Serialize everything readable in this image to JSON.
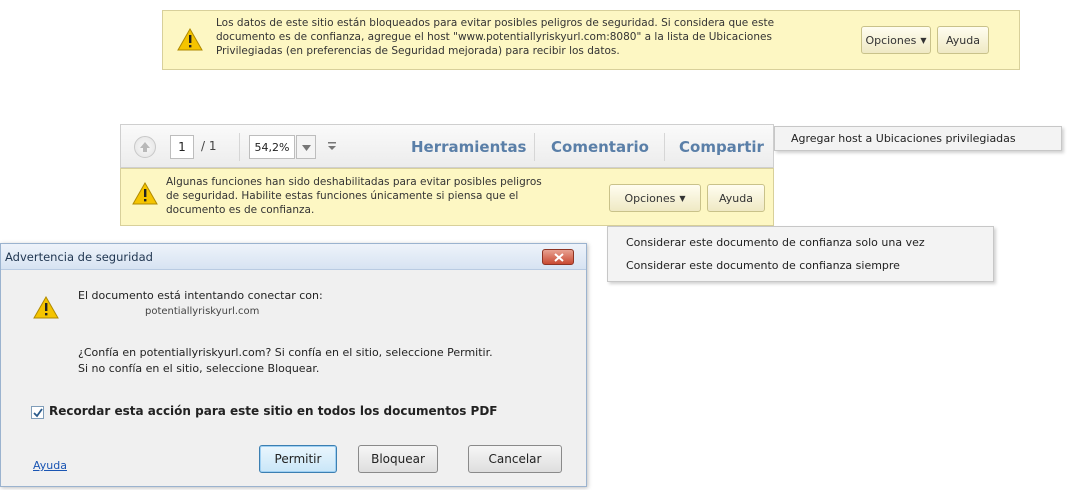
{
  "bar1": {
    "message_lines": [
      "Los datos de este sitio están bloqueados para evitar posibles peligros de seguridad. Si considera que este",
      "documento es de confianza, agregue el host  \"www.potentiallyriskyurl.com:8080\"  a la lista de Ubicaciones",
      "Privilegiadas (en preferencias de Seguridad mejorada) para recibir los datos."
    ],
    "options_label": "Opciones",
    "help_label": "Ayuda"
  },
  "toolbar": {
    "page_current": "1",
    "page_total": "/ 1",
    "zoom": "54,2%",
    "tools_label": "Herramientas",
    "comment_label": "Comentario",
    "share_label": "Compartir"
  },
  "menu1": {
    "item": "Agregar host a Ubicaciones privilegiadas"
  },
  "bar2": {
    "message_lines": [
      "Algunas funciones han sido deshabilitadas para evitar posibles peligros",
      "de seguridad. Habilite estas funciones únicamente si piensa que el",
      "documento es de confianza."
    ],
    "options_label": "Opciones",
    "help_label": "Ayuda"
  },
  "menu2": {
    "items": [
      "Considerar este documento de confianza solo una vez",
      "Considerar este documento de confianza siempre"
    ]
  },
  "dialog": {
    "title": "Advertencia de seguridad",
    "connect_text": "El documento está intentando conectar con:",
    "host": "potentiallyriskyurl.com",
    "question_line1": "¿Confía en potentiallyriskyurl.com? Si confía en el sitio, seleccione Permitir.",
    "question_line2": "Si no confía en  el sitio, seleccione Bloquear.",
    "remember_label": "Recordar esta acción para este sitio en todos los documentos PDF",
    "remember_checked": true,
    "help_link": "Ayuda",
    "allow_label": "Permitir",
    "block_label": "Bloquear",
    "cancel_label": "Cancelar"
  },
  "colors": {
    "warning_bar": "#fdf7c3",
    "toolbar_link": "#5a7fa8",
    "link": "#1a55b3",
    "close_button": "#c94a32"
  }
}
